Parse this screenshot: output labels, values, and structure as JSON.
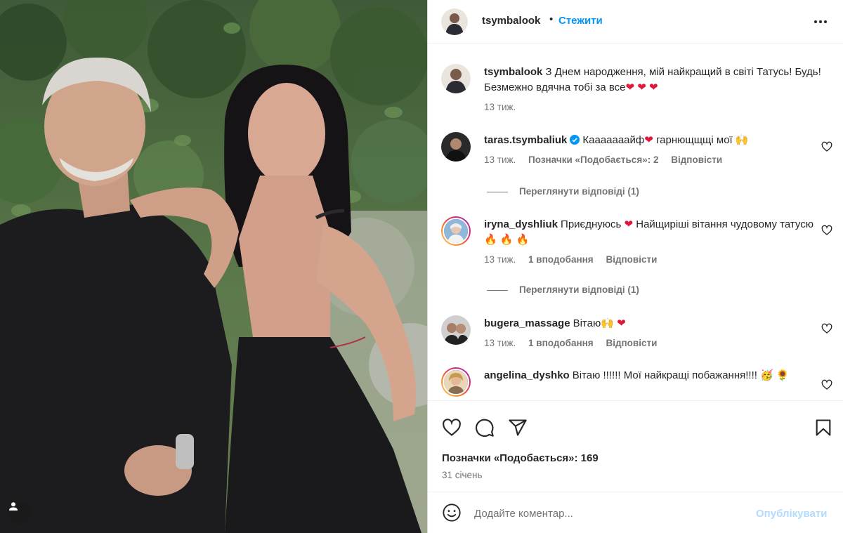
{
  "photo": {
    "alt_icon": "tag-user-icon"
  },
  "post": {
    "author": "tsymbalook",
    "dot": "•",
    "follow_label": "Стежити",
    "more_icon": "more-options-icon"
  },
  "caption": {
    "username": "tsymbalook",
    "text": "З Днем народження, мій найкращий в світі Татусь! Будь! Безмежно вдячна тобі за все",
    "emoji": "❤ ❤ ❤",
    "time": "13 тиж."
  },
  "comments": [
    {
      "username": "taras.tsymbaliuk",
      "verified": true,
      "text_before": "Кааааааайф",
      "emoji_mid": "❤",
      "text_after": " гарнющщщі мої 🙌",
      "time": "13 тиж.",
      "likes": "Позначки «Подобається»: 2",
      "reply": "Відповісти",
      "view_replies": "Переглянути відповіді (1)"
    },
    {
      "username": "iryna_dyshliuk",
      "text_before": "Приєднуюсь ",
      "emoji_mid": "❤",
      "text_after": " Найщиріші вітання чудовому татусю 🔥 🔥 🔥",
      "time": "13 тиж.",
      "likes": "1 вподобання",
      "reply": "Відповісти",
      "view_replies": "Переглянути відповіді (1)"
    },
    {
      "username": "bugera_massage",
      "text_before": "Вітаю🙌 ",
      "emoji_mid": "❤",
      "text_after": "",
      "time": "13 тиж.",
      "likes": "1 вподобання",
      "reply": "Відповісти"
    },
    {
      "username": "angelina_dyshko",
      "text_before": "Вітаю !!!!!! Мої найкращі побажання!!!! 🥳 🌻",
      "emoji_mid": "",
      "text_after": ""
    }
  ],
  "actions": {
    "likes_label": "Позначки «Подобається»: 169",
    "date": "31 січень"
  },
  "composer": {
    "placeholder": "Додайте коментар...",
    "publish_label": "Опублікувати"
  },
  "colors": {
    "accent": "#0095f6",
    "heart": "#e0163a",
    "publish_disabled": "#b3dbff",
    "muted_text": "#737373"
  }
}
